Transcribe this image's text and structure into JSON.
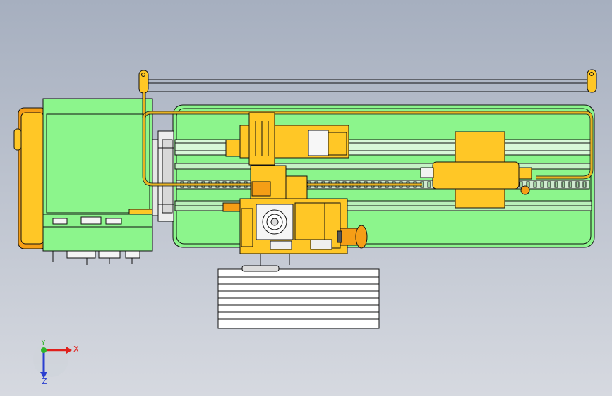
{
  "viewport": {
    "background_top": "#a6afbf",
    "background_bottom": "#d6d9e0"
  },
  "colors": {
    "body_green": "#8cf58c",
    "part_yellow": "#ffc726",
    "part_orange": "#f59e16",
    "outline": "#111111",
    "cable": "#e8b320"
  },
  "triad": {
    "x_label": "X",
    "y_label": "Y",
    "z_label": "Z",
    "x_color": "#e0201c",
    "y_color": "#2fb52a",
    "z_color": "#2a3fd0"
  }
}
